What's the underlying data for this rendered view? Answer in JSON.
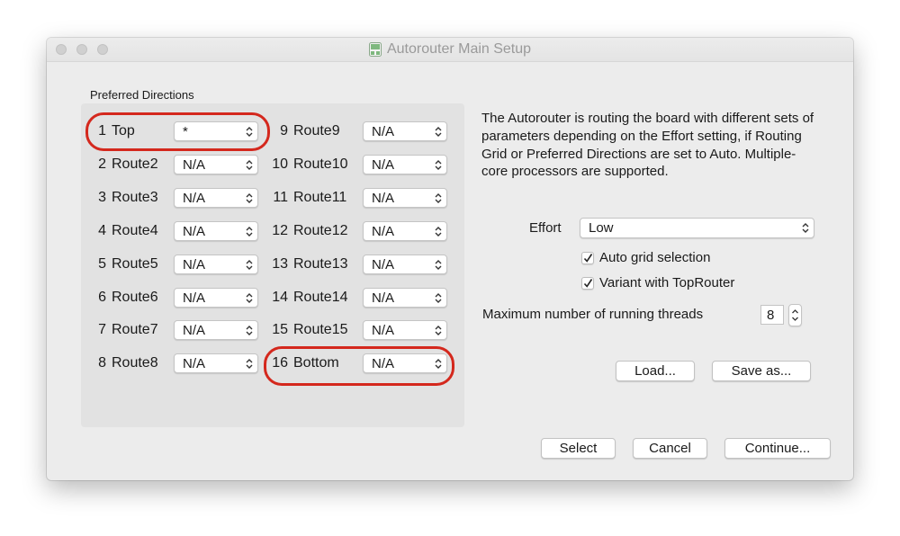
{
  "window": {
    "title": "Autorouter Main Setup",
    "title_icon": "app-icon"
  },
  "preferred_directions": {
    "label": "Preferred Directions",
    "layers_left": [
      {
        "num": "1",
        "name": "Top",
        "value": "*"
      },
      {
        "num": "2",
        "name": "Route2",
        "value": "N/A"
      },
      {
        "num": "3",
        "name": "Route3",
        "value": "N/A"
      },
      {
        "num": "4",
        "name": "Route4",
        "value": "N/A"
      },
      {
        "num": "5",
        "name": "Route5",
        "value": "N/A"
      },
      {
        "num": "6",
        "name": "Route6",
        "value": "N/A"
      },
      {
        "num": "7",
        "name": "Route7",
        "value": "N/A"
      },
      {
        "num": "8",
        "name": "Route8",
        "value": "N/A"
      }
    ],
    "layers_right": [
      {
        "num": "9",
        "name": "Route9",
        "value": "N/A"
      },
      {
        "num": "10",
        "name": "Route10",
        "value": "N/A"
      },
      {
        "num": "11",
        "name": "Route11",
        "value": "N/A"
      },
      {
        "num": "12",
        "name": "Route12",
        "value": "N/A"
      },
      {
        "num": "13",
        "name": "Route13",
        "value": "N/A"
      },
      {
        "num": "14",
        "name": "Route14",
        "value": "N/A"
      },
      {
        "num": "15",
        "name": "Route15",
        "value": "N/A"
      },
      {
        "num": "16",
        "name": "Bottom",
        "value": "N/A"
      }
    ]
  },
  "description": "The Autorouter is routing the board with different sets of parameters depending on the Effort setting, if Routing Grid or Preferred Directions are set to Auto. Multiple-core processors are supported.",
  "effort": {
    "label": "Effort",
    "value": "Low"
  },
  "options": {
    "auto_grid": {
      "label": "Auto grid selection",
      "checked": true
    },
    "variant_toprouter": {
      "label": "Variant with TopRouter",
      "checked": true
    }
  },
  "threads": {
    "label": "Maximum number of running threads",
    "value": "8"
  },
  "buttons": {
    "load": "Load...",
    "save_as": "Save as...",
    "select": "Select",
    "cancel": "Cancel",
    "continue": "Continue..."
  },
  "colors": {
    "highlight": "#d4281d",
    "window_bg": "#ececec",
    "group_bg": "#e2e2e2"
  }
}
